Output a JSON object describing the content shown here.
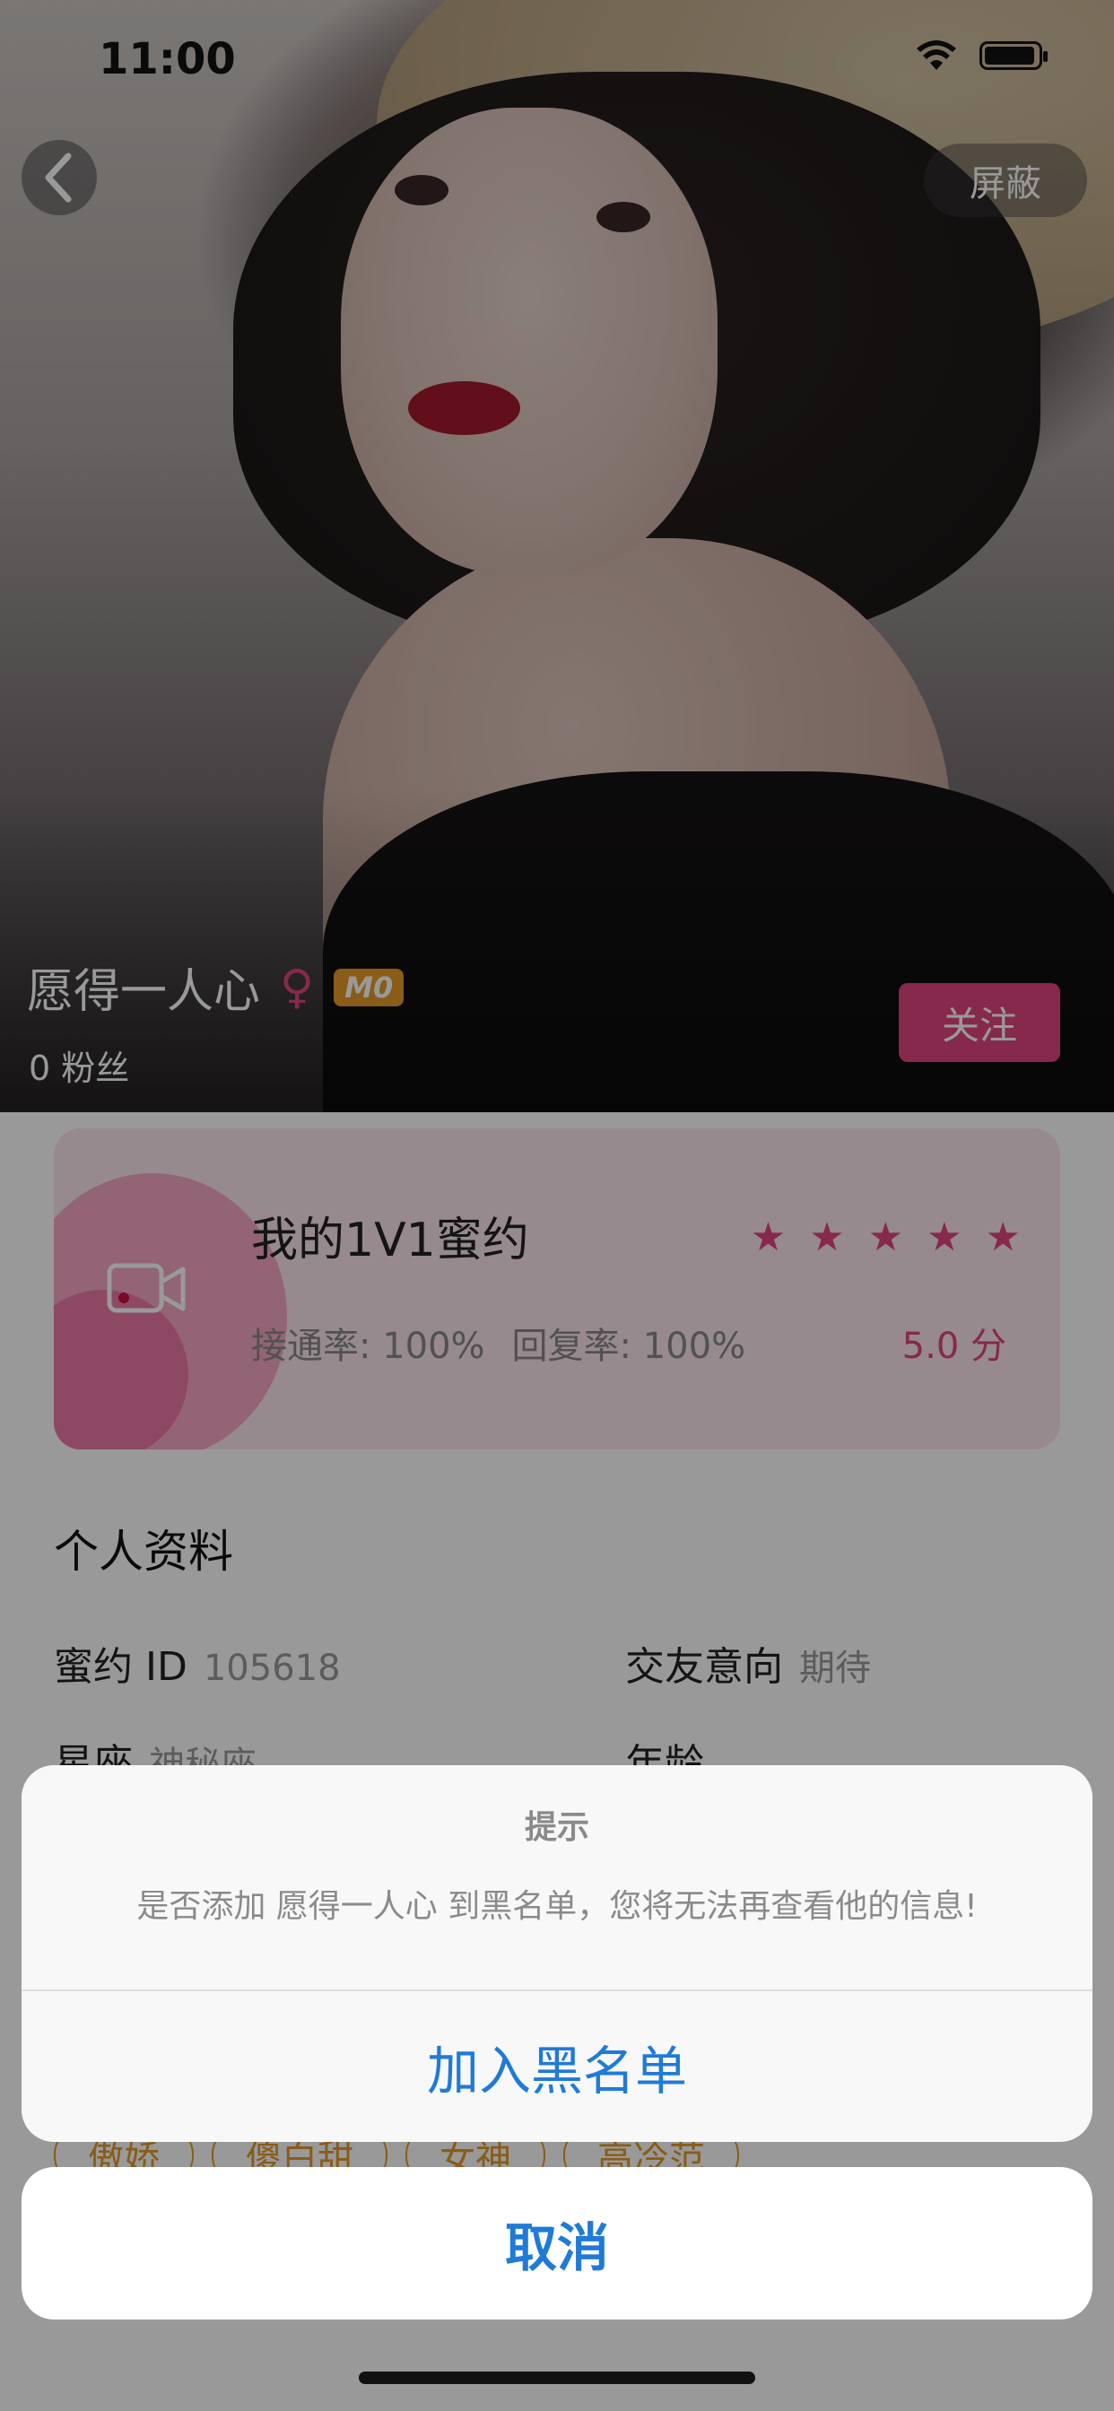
{
  "status_bar": {
    "time": "11:00"
  },
  "header": {
    "block_label": "屏蔽"
  },
  "profile": {
    "nickname": "愿得一人心",
    "gender_symbol": "♀",
    "level": "M0",
    "fans": "0 粉丝",
    "follow_label": "关注"
  },
  "date_card": {
    "title": "我的1V1蜜约",
    "stars": 5,
    "connect_rate": "接通率: 100%",
    "reply_rate": "回复率: 100%",
    "score": "5.0 分"
  },
  "profile_info": {
    "section_title": "个人资料",
    "id_label": "蜜约 ID",
    "id_value": "105618",
    "intent_label": "交友意向",
    "intent_value": "期待",
    "zodiac_label": "星座",
    "zodiac_value": "神秘座",
    "age_label": "年龄",
    "age_value": "-",
    "tags": [
      "傲娇",
      "傻白甜",
      "女神",
      "高冷范"
    ]
  },
  "action_sheet": {
    "title": "提示",
    "message": "是否添加 愿得一人心 到黑名单，您将无法再查看他的信息!",
    "confirm_label": "加入黑名单",
    "cancel_label": "取消"
  },
  "colors": {
    "accent_pink": "#e0457f",
    "level_orange": "#e59a27",
    "action_blue": "#1f7ad8"
  }
}
